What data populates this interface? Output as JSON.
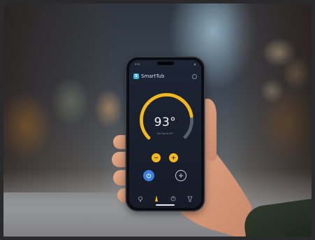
{
  "app": {
    "name": "SmartTub",
    "logo_letter": "S",
    "temperature": "93°",
    "temperature_sub": "Set Temp 93°",
    "target_level": 0.8,
    "minus_label": "−",
    "plus_label": "+",
    "status_time": "9:41"
  },
  "colors": {
    "accent": "#f3b81b",
    "power": "#3c7ee0",
    "logo": "#3fb3e6",
    "screen": "#1d2433"
  },
  "icons": [
    "settings-icon",
    "power-icon",
    "fan-icon",
    "bulb-icon",
    "jets-icon",
    "thermometer-icon",
    "filter-icon"
  ]
}
